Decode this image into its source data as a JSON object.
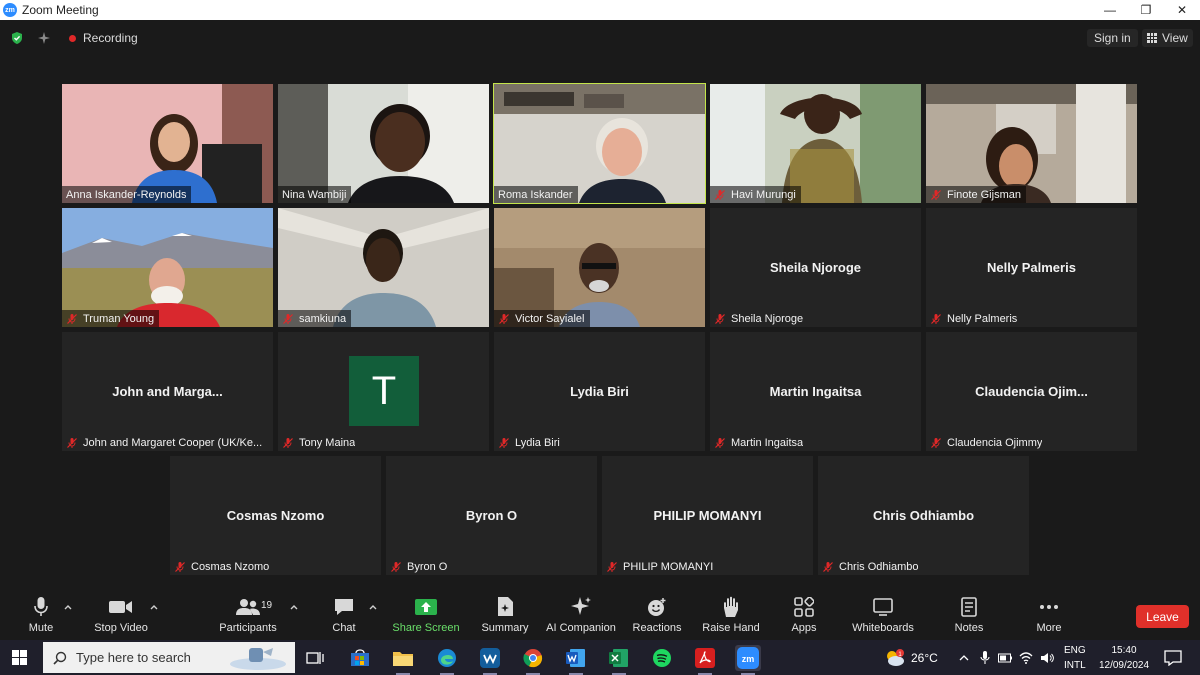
{
  "window": {
    "logo_text": "zm",
    "title": "Zoom Meeting",
    "minimize": "—",
    "maximize": "❐",
    "close": "✕"
  },
  "topbar": {
    "recording_label": "Recording",
    "signin_label": "Sign in",
    "view_label": "View"
  },
  "gallery": [
    {
      "name": "Anna Iskander-Reynolds",
      "muted": false,
      "video": true
    },
    {
      "name": "Nina Wambiji",
      "muted": false,
      "video": true
    },
    {
      "name": "Roma Iskander",
      "muted": false,
      "video": true,
      "active_speaker": true
    },
    {
      "name": "Havi Murungi",
      "muted": true,
      "video": true
    },
    {
      "name": "Finote Gijsman",
      "muted": true,
      "video": true
    },
    {
      "name": "Truman Young",
      "muted": true,
      "video": true
    },
    {
      "name": "samkiuna",
      "muted": true,
      "video": true
    },
    {
      "name": "Victor Sayialel",
      "muted": true,
      "video": true
    },
    {
      "name": "Sheila Njoroge",
      "display": "Sheila Njoroge",
      "muted": true,
      "video": false
    },
    {
      "name": "Nelly Palmeris",
      "display": "Nelly Palmeris",
      "muted": true,
      "video": false
    },
    {
      "name": "John and Margaret Cooper (UK/Ke...",
      "display": "John and Marga...",
      "muted": true,
      "video": false
    },
    {
      "name": "Tony Maina",
      "avatar_letter": "T",
      "muted": true,
      "video": false
    },
    {
      "name": "Lydia Biri",
      "display": "Lydia Biri",
      "muted": true,
      "video": false
    },
    {
      "name": "Martin Ingaitsa",
      "display": "Martin Ingaitsa",
      "muted": true,
      "video": false
    },
    {
      "name": "Claudencia Ojimmy",
      "display": "Claudencia  Ojim...",
      "muted": true,
      "video": false
    },
    {
      "name": "Cosmas Nzomo",
      "display": "Cosmas Nzomo",
      "muted": true,
      "video": false
    },
    {
      "name": "Byron O",
      "display": "Byron O",
      "muted": true,
      "video": false
    },
    {
      "name": "PHILIP MOMANYI",
      "display": "PHILIP MOMANYI",
      "muted": true,
      "video": false
    },
    {
      "name": "Chris Odhiambo",
      "display": "Chris Odhiambo",
      "muted": true,
      "video": false
    }
  ],
  "toolbar": {
    "mute": "Mute",
    "stop_video": "Stop Video",
    "participants": "Participants",
    "participant_count": "19",
    "chat": "Chat",
    "share_screen": "Share Screen",
    "summary": "Summary",
    "ai_companion": "AI Companion",
    "reactions": "Reactions",
    "raise_hand": "Raise Hand",
    "apps": "Apps",
    "whiteboards": "Whiteboards",
    "notes": "Notes",
    "more": "More",
    "leave": "Leave"
  },
  "taskbar": {
    "search_placeholder": "Type here to search",
    "zoom_app_label": "zm",
    "weather_temp": "26°C",
    "weather_badge": "1",
    "lang_top": "ENG",
    "lang_bottom": "INTL",
    "time": "15:40",
    "date": "12/09/2024"
  },
  "colors": {
    "active_speaker_border": "#c4e54a",
    "leave_button": "#e0302a",
    "share_screen_green": "#2bb24c",
    "muted_red": "#e02828",
    "avatar_green": "#125e3a"
  }
}
